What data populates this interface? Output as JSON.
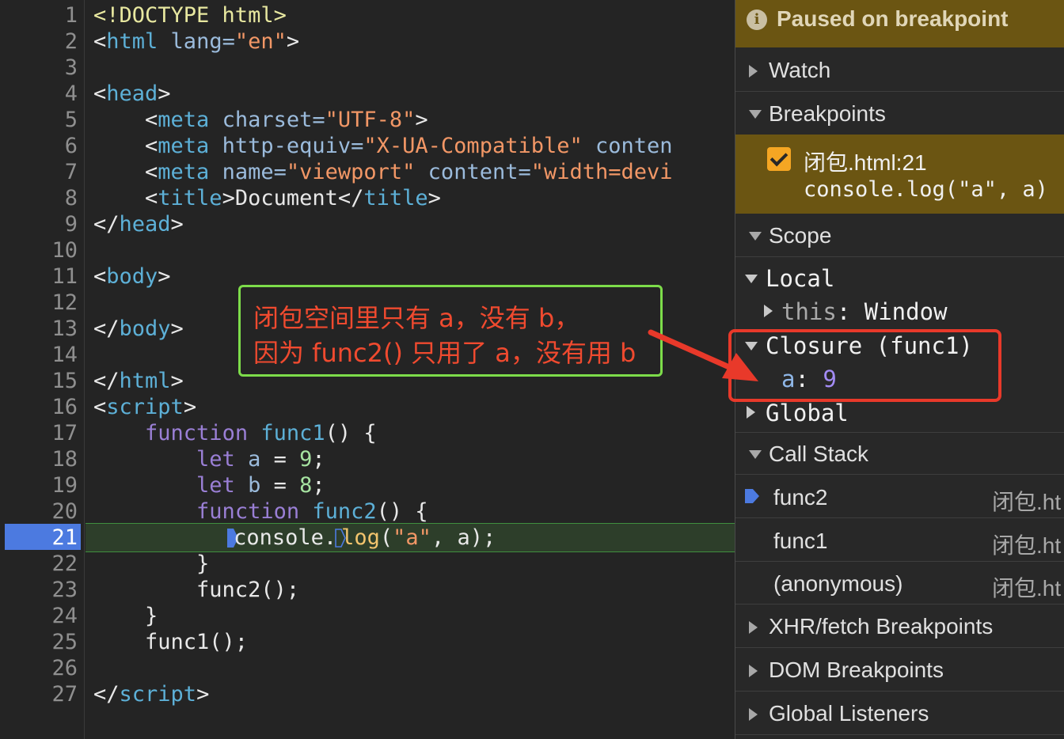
{
  "editor": {
    "line_numbers": [
      "1",
      "2",
      "3",
      "4",
      "5",
      "6",
      "7",
      "8",
      "9",
      "10",
      "11",
      "12",
      "13",
      "14",
      "15",
      "16",
      "17",
      "18",
      "19",
      "20",
      "21",
      "22",
      "23",
      "24",
      "25",
      "26",
      "27"
    ],
    "active_line": "21",
    "code": {
      "l1": "<!DOCTYPE html>",
      "l2_open": "<",
      "l2_tag": "html",
      "l2_attr": " lang=",
      "l2_val": "\"en\"",
      "l2_close": ">",
      "l4_open": "<",
      "l4_tag": "head",
      "l4_close": ">",
      "l5_indent": "    <",
      "l5_tag": "meta",
      "l5_attr": " charset=",
      "l5_val": "\"UTF-8\"",
      "l5_close": ">",
      "l6_indent": "    <",
      "l6_tag": "meta",
      "l6_attr": " http-equiv=",
      "l6_val": "\"X-UA-Compatible\"",
      "l6_attr2": " conten",
      "l7_indent": "    <",
      "l7_tag": "meta",
      "l7_attr": " name=",
      "l7_val": "\"viewport\"",
      "l7_attr2": " content=",
      "l7_val2": "\"width=devi",
      "l8_indent": "    <",
      "l8_tag": "title",
      "l8_mid": ">Document</",
      "l8_tag2": "title",
      "l8_close": ">",
      "l9_open": "</",
      "l9_tag": "head",
      "l9_close": ">",
      "l11_open": "<",
      "l11_tag": "body",
      "l11_close": ">",
      "l13_open": "</",
      "l13_tag": "body",
      "l13_close": ">",
      "l15_open": "</",
      "l15_tag": "html",
      "l15_close": ">",
      "l16_open": "<",
      "l16_tag": "script",
      "l16_close": ">",
      "l17_indent": "    ",
      "l17_kw": "function",
      "l17_fn": " func1",
      "l17_rest": "() {",
      "l18_indent": "        ",
      "l18_kw": "let",
      "l18_var": " a",
      "l18_eq": " = ",
      "l18_num": "9",
      "l18_end": ";",
      "l19_indent": "        ",
      "l19_kw": "let",
      "l19_var": " b",
      "l19_eq": " = ",
      "l19_num": "8",
      "l19_end": ";",
      "l20_indent": "        ",
      "l20_kw": "function",
      "l20_fn": " func2",
      "l20_rest": "() {",
      "l21_indent": "            ",
      "l21_obj": "console.",
      "l21_fn": "log",
      "l21_p1": "(",
      "l21_str": "\"a\"",
      "l21_rest": ", a);",
      "l22": "        }",
      "l23": "        func2();",
      "l24": "    }",
      "l25": "    func1();",
      "l27_open": "</",
      "l27_tag": "script",
      "l27_close": ">"
    },
    "annotation": {
      "line1": "闭包空间里只有 a，没有 b，",
      "line2": "因为 func2() 只用了 a，没有用 b"
    }
  },
  "debugger": {
    "paused_text": "Paused on breakpoint",
    "sections": {
      "watch": "Watch",
      "breakpoints": "Breakpoints",
      "scope": "Scope",
      "call_stack": "Call Stack",
      "xhr": "XHR/fetch Breakpoints",
      "dom": "DOM Breakpoints",
      "global_listeners": "Global Listeners"
    },
    "breakpoint": {
      "file": "闭包.html:21",
      "code": "console.log(\"a\", a)",
      "checked": true
    },
    "scope": {
      "local": "Local",
      "this_key": "this",
      "this_sep": ": ",
      "this_val": "Window",
      "closure": "Closure (func1)",
      "a_key": "a",
      "a_sep": ": ",
      "a_val": "9",
      "global": "Global"
    },
    "call_stack": [
      {
        "name": "func2",
        "location": "闭包.ht",
        "current": true
      },
      {
        "name": "func1",
        "location": "闭包.ht",
        "current": false
      },
      {
        "name": "(anonymous)",
        "location": "闭包.ht",
        "current": false
      }
    ]
  },
  "colors": {
    "paused_bg": "#6b5512",
    "breakpoint_blue": "#4c7ae0",
    "annotation_red": "#f04a2f",
    "annotation_green": "#7ddc4a"
  }
}
